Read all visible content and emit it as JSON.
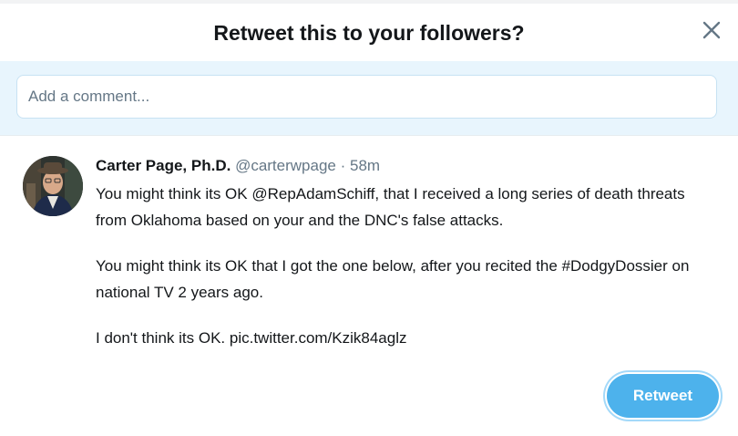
{
  "dialog": {
    "title": "Retweet this to your followers?",
    "close_icon": "close-icon"
  },
  "compose": {
    "placeholder": "Add a comment...",
    "value": ""
  },
  "tweet": {
    "author_name": "Carter Page, Ph.D.",
    "handle": "@carterwpage",
    "separator": "·",
    "time": "58m",
    "paragraphs": [
      "You might think its OK @RepAdamSchiff, that I received a long series of death threats from Oklahoma based on your and the DNC's false attacks.",
      "You might think its OK that I got the one below, after you recited the #DodgyDossier on national TV 2 years ago.",
      "I don't think its OK. pic.twitter.com/Kzik84aglz"
    ]
  },
  "actions": {
    "retweet_label": "Retweet"
  },
  "colors": {
    "accent": "#4db2ec",
    "compose_background": "#e8f5fd",
    "text_primary": "#14171a",
    "text_secondary": "#657786"
  }
}
